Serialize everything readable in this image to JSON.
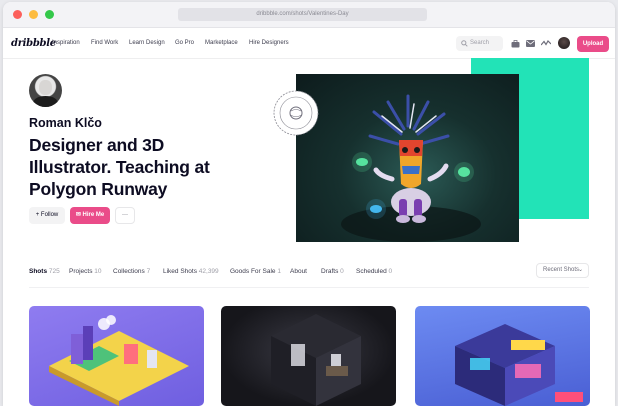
{
  "browser": {
    "url": "dribbble.com/shots/Valentines-Day",
    "dots": [
      "#fc605c",
      "#fdbc40",
      "#34c84a"
    ]
  },
  "nav": {
    "logo": "dribbble",
    "links": [
      "Inspiration",
      "Find Work",
      "Learn Design",
      "Go Pro",
      "Marketplace",
      "Hire Designers"
    ],
    "search_placeholder": "Search",
    "upload_label": "Upload"
  },
  "profile": {
    "name": "Roman Klčo",
    "headline": "Designer and 3D Illustrator. Teaching at Polygon Runway",
    "follow_label": "+ Follow",
    "hire_label": "✉ Hire Me",
    "more_label": "···"
  },
  "tabs": [
    {
      "label": "Shots",
      "count": "725"
    },
    {
      "label": "Projects",
      "count": "10"
    },
    {
      "label": "Collections",
      "count": "7"
    },
    {
      "label": "Liked Shots",
      "count": "42,399"
    },
    {
      "label": "Goods For Sale",
      "count": "1"
    },
    {
      "label": "About",
      "count": ""
    },
    {
      "label": "Drafts",
      "count": "0"
    },
    {
      "label": "Scheduled",
      "count": "0"
    }
  ],
  "sort": {
    "label": "Recent Shots"
  },
  "colors": {
    "brand_pink": "#ea4c89",
    "accent_teal": "#22e3b7",
    "text_dark": "#0d0c22"
  }
}
